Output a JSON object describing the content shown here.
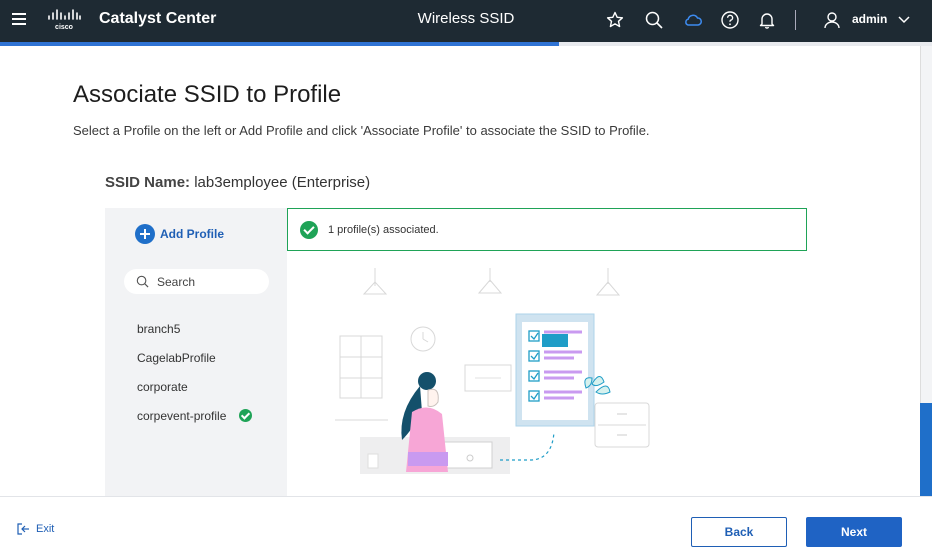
{
  "header": {
    "app_name": "Catalyst Center",
    "page_title": "Wireless SSID",
    "user_name": "admin",
    "logo_text": "cisco"
  },
  "progress": {
    "fraction": 0.6
  },
  "main": {
    "title": "Associate SSID to Profile",
    "subtitle": "Select a Profile on the left or Add Profile and click 'Associate Profile' to associate the SSID to Profile.",
    "ssid_label": "SSID Name:",
    "ssid_value": "lab3employee (Enterprise)"
  },
  "left_panel": {
    "add_profile_label": "Add Profile",
    "search_placeholder": "Search",
    "profiles": [
      {
        "name": "branch5",
        "associated": false
      },
      {
        "name": "CagelabProfile",
        "associated": false
      },
      {
        "name": "corporate",
        "associated": false
      },
      {
        "name": "corpevent-profile",
        "associated": true
      }
    ]
  },
  "association": {
    "banner_text": "1 profile(s) associated."
  },
  "footer": {
    "exit_label": "Exit",
    "back_label": "Back",
    "next_label": "Next"
  },
  "colors": {
    "topbar_bg": "#1e2a33",
    "accent": "#1f63c4",
    "success": "#1fa357"
  }
}
